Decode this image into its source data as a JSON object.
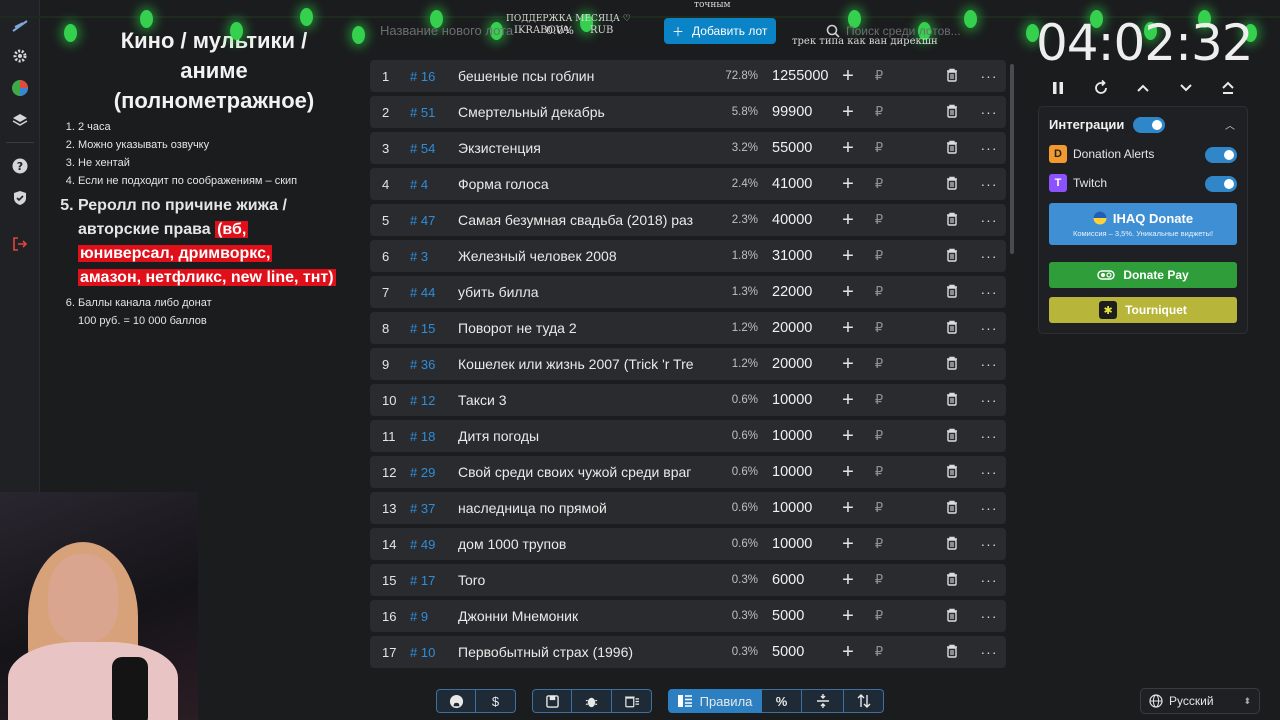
{
  "rules": {
    "title": "Кино / мультики / аниме (полнометражное)",
    "items": [
      "2 часа",
      "Можно указывать озвучку",
      "Не хентай",
      "Если не подходит по соображениям – скип",
      "Ролл по причине жижа / авторские права",
      "Баллы канала либо донат"
    ],
    "item5_pre": "Реролл по причине жижа / авторские права ",
    "item5_red1": "(вб,",
    "item5_red2": "юниверсал, дримворкс,",
    "item5_red3": "амазон, нетфликс, new line, тнт)",
    "item6_line2": "100 руб. = 10 000 баллов"
  },
  "top": {
    "input_placeholder": "Название нового лота",
    "overlay_support": "ПОДДЕРЖКА МЕСЯЦА ♡",
    "overlay_user": "IKRABOVA",
    "overlay_pct": "0.0%",
    "overlay_rub": "RUB",
    "overlay_word": "точным",
    "overlay_caption": "трек типа как ван дирекшн",
    "add_label": "Добавить лот",
    "search_placeholder": "Поиск среди лотов..."
  },
  "lots": [
    {
      "n": "1",
      "id": "# 16",
      "name": "бешеные псы гоблин",
      "pct": "72.8%",
      "amount": "1255000"
    },
    {
      "n": "2",
      "id": "# 51",
      "name": "Смертельный декабрь",
      "pct": "5.8%",
      "amount": "99900"
    },
    {
      "n": "3",
      "id": "# 54",
      "name": "Экзистенция",
      "pct": "3.2%",
      "amount": "55000"
    },
    {
      "n": "4",
      "id": "# 4",
      "name": "Форма голоса",
      "pct": "2.4%",
      "amount": "41000"
    },
    {
      "n": "5",
      "id": "# 47",
      "name": "Самая безумная свадьба (2018) раз",
      "pct": "2.3%",
      "amount": "40000"
    },
    {
      "n": "6",
      "id": "# 3",
      "name": "Железный человек 2008",
      "pct": "1.8%",
      "amount": "31000"
    },
    {
      "n": "7",
      "id": "# 44",
      "name": "убить билла",
      "pct": "1.3%",
      "amount": "22000"
    },
    {
      "n": "8",
      "id": "# 15",
      "name": "Поворот не туда 2",
      "pct": "1.2%",
      "amount": "20000"
    },
    {
      "n": "9",
      "id": "# 36",
      "name": "Кошелек или жизнь 2007 (Trick 'r Tre",
      "pct": "1.2%",
      "amount": "20000"
    },
    {
      "n": "10",
      "id": "# 12",
      "name": "Такси 3",
      "pct": "0.6%",
      "amount": "10000"
    },
    {
      "n": "11",
      "id": "# 18",
      "name": "Дитя погоды",
      "pct": "0.6%",
      "amount": "10000"
    },
    {
      "n": "12",
      "id": "# 29",
      "name": "Свой среди своих чужой среди враг",
      "pct": "0.6%",
      "amount": "10000"
    },
    {
      "n": "13",
      "id": "# 37",
      "name": "наследница по прямой",
      "pct": "0.6%",
      "amount": "10000"
    },
    {
      "n": "14",
      "id": "# 49",
      "name": "дом 1000 трупов",
      "pct": "0.6%",
      "amount": "10000"
    },
    {
      "n": "15",
      "id": "# 17",
      "name": "Toro",
      "pct": "0.3%",
      "amount": "6000"
    },
    {
      "n": "16",
      "id": "# 9",
      "name": "Джонни Мнемоник",
      "pct": "0.3%",
      "amount": "5000"
    },
    {
      "n": "17",
      "id": "# 10",
      "name": "Первобытный страх (1996)",
      "pct": "0.3%",
      "amount": "5000"
    }
  ],
  "lot_labels": {
    "plus": "+",
    "rub": "₽",
    "more": "···"
  },
  "toolbar": {
    "rules_label": "Правила",
    "percent_label": "%"
  },
  "language": "Русский",
  "timer": "04:02:32",
  "integrations": {
    "title": "Интеграции",
    "donation_alerts": "Donation Alerts",
    "twitch": "Twitch",
    "ihaq_title": "IHAQ Donate",
    "ihaq_sub": "Комиссия – 3,5%. Уникальные виджеты!",
    "donate_pay": "Donate Pay",
    "tourniquet": "Tourniquet"
  },
  "colors": {
    "accent": "#2f86c9",
    "lot_id": "#2f8dd9",
    "ihaq": "#3f8fd4",
    "donate_pay": "#2f9e3a",
    "tourniquet": "#b7b63a",
    "rules_red": "#e0101a"
  }
}
